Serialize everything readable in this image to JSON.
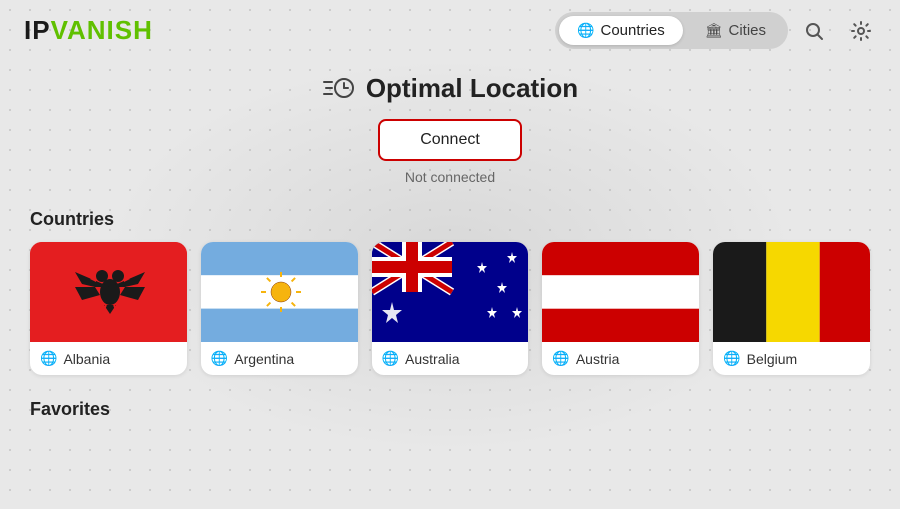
{
  "logo": {
    "ip": "IP",
    "vanish": "VANISH"
  },
  "header": {
    "tabs": [
      {
        "id": "countries",
        "label": "Countries",
        "icon": "🌐",
        "active": true
      },
      {
        "id": "cities",
        "label": "Cities",
        "icon": "🏛",
        "active": false
      }
    ]
  },
  "optimal": {
    "title": "Optimal Location",
    "connect_label": "Connect",
    "status": "Not connected"
  },
  "countries_section": {
    "label": "Countries",
    "items": [
      {
        "name": "Albania"
      },
      {
        "name": "Argentina"
      },
      {
        "name": "Australia"
      },
      {
        "name": "Austria"
      },
      {
        "name": "Belgium"
      }
    ]
  },
  "favorites_section": {
    "label": "Favorites"
  },
  "icons": {
    "search": "🔍",
    "settings": "⚙️"
  }
}
